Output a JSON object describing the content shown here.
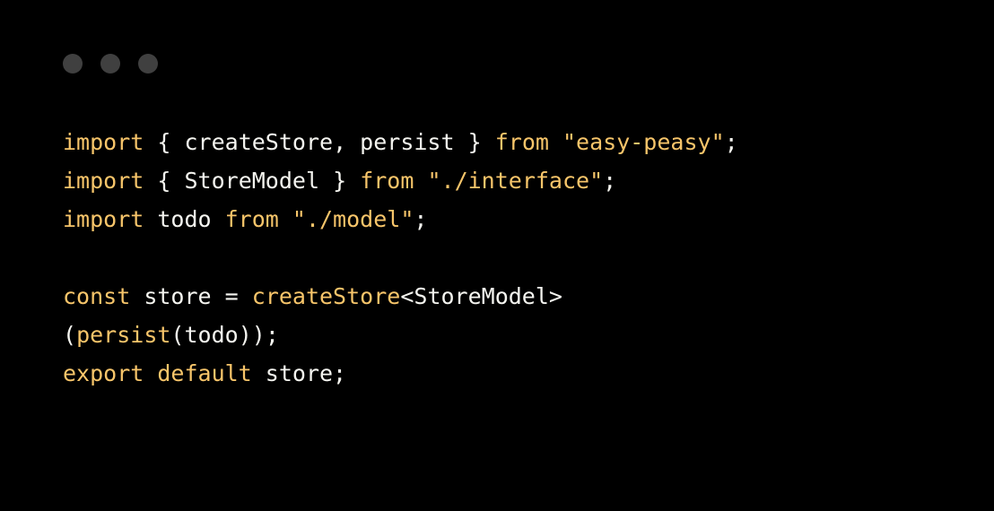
{
  "traffic_lights": {
    "count": 3
  },
  "code": {
    "lines": [
      {
        "tokens": [
          {
            "t": "import",
            "c": "c-keyword"
          },
          {
            "t": " ",
            "c": "c-ident"
          },
          {
            "t": "{",
            "c": "c-punct"
          },
          {
            "t": " createStore",
            "c": "c-ident"
          },
          {
            "t": ",",
            "c": "c-punct"
          },
          {
            "t": " persist ",
            "c": "c-ident"
          },
          {
            "t": "}",
            "c": "c-punct"
          },
          {
            "t": " ",
            "c": "c-ident"
          },
          {
            "t": "from",
            "c": "c-keyword"
          },
          {
            "t": " ",
            "c": "c-ident"
          },
          {
            "t": "\"easy-peasy\"",
            "c": "c-string"
          },
          {
            "t": ";",
            "c": "c-punct"
          }
        ]
      },
      {
        "tokens": [
          {
            "t": "import",
            "c": "c-keyword"
          },
          {
            "t": " ",
            "c": "c-ident"
          },
          {
            "t": "{",
            "c": "c-punct"
          },
          {
            "t": " StoreModel ",
            "c": "c-ident"
          },
          {
            "t": "}",
            "c": "c-punct"
          },
          {
            "t": " ",
            "c": "c-ident"
          },
          {
            "t": "from",
            "c": "c-keyword"
          },
          {
            "t": " ",
            "c": "c-ident"
          },
          {
            "t": "\"./interface\"",
            "c": "c-string"
          },
          {
            "t": ";",
            "c": "c-punct"
          }
        ]
      },
      {
        "tokens": [
          {
            "t": "import",
            "c": "c-keyword"
          },
          {
            "t": " todo ",
            "c": "c-ident"
          },
          {
            "t": "from",
            "c": "c-keyword"
          },
          {
            "t": " ",
            "c": "c-ident"
          },
          {
            "t": "\"./model\"",
            "c": "c-string"
          },
          {
            "t": ";",
            "c": "c-punct"
          }
        ]
      },
      {
        "tokens": [
          {
            "t": " ",
            "c": "c-ident"
          }
        ]
      },
      {
        "tokens": [
          {
            "t": "const",
            "c": "c-keyword"
          },
          {
            "t": " store ",
            "c": "c-ident"
          },
          {
            "t": "=",
            "c": "c-op"
          },
          {
            "t": " ",
            "c": "c-ident"
          },
          {
            "t": "createStore",
            "c": "c-call"
          },
          {
            "t": "<",
            "c": "c-punct"
          },
          {
            "t": "StoreModel",
            "c": "c-type"
          },
          {
            "t": ">",
            "c": "c-punct"
          }
        ]
      },
      {
        "tokens": [
          {
            "t": "(",
            "c": "c-punct"
          },
          {
            "t": "persist",
            "c": "c-call"
          },
          {
            "t": "(",
            "c": "c-punct"
          },
          {
            "t": "todo",
            "c": "c-ident"
          },
          {
            "t": ")",
            "c": "c-punct"
          },
          {
            "t": ")",
            "c": "c-punct"
          },
          {
            "t": ";",
            "c": "c-punct"
          }
        ]
      },
      {
        "tokens": [
          {
            "t": "export",
            "c": "c-keyword"
          },
          {
            "t": " ",
            "c": "c-ident"
          },
          {
            "t": "default",
            "c": "c-keyword"
          },
          {
            "t": " store",
            "c": "c-ident"
          },
          {
            "t": ";",
            "c": "c-punct"
          }
        ]
      }
    ]
  }
}
